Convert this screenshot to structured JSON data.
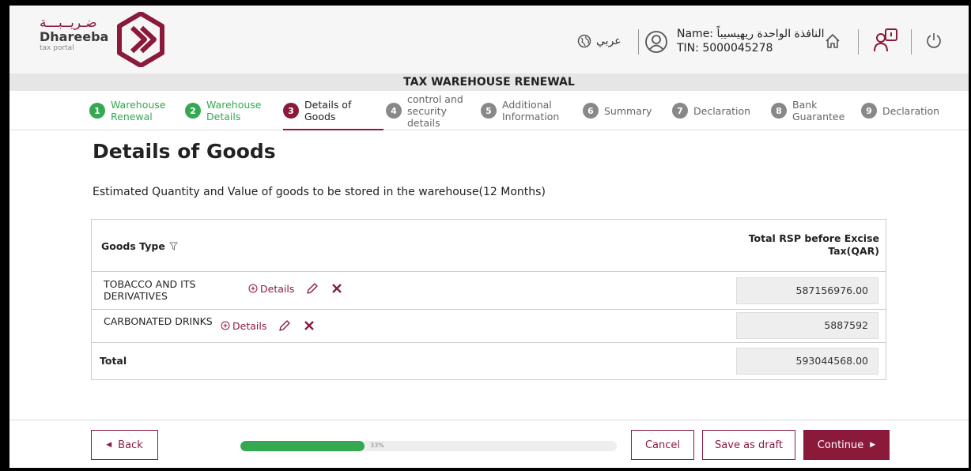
{
  "header": {
    "logo_arabic": "ضـريــبـــة",
    "logo_name": "Dhareeba",
    "logo_sub": "tax portal",
    "language": "عربي",
    "user_name": "Name: النافذة الواحدة ريهيسيباً",
    "user_tin": "TIN: 5000045278",
    "icons": [
      "globe-icon",
      "user-icon",
      "home-icon",
      "help-icon",
      "power-icon"
    ]
  },
  "page_header": "TAX WAREHOUSE RENEWAL",
  "steps": [
    {
      "num": "1",
      "label": "Warehouse Renewal",
      "state": "done"
    },
    {
      "num": "2",
      "label": "Warehouse Details",
      "state": "done"
    },
    {
      "num": "3",
      "label": "Details of Goods",
      "state": "active"
    },
    {
      "num": "4",
      "label": "control and security details",
      "state": "todo"
    },
    {
      "num": "5",
      "label": "Additional Information",
      "state": "todo"
    },
    {
      "num": "6",
      "label": "Summary",
      "state": "todo"
    },
    {
      "num": "7",
      "label": "Declaration",
      "state": "todo"
    },
    {
      "num": "8",
      "label": "Bank Guarantee",
      "state": "todo"
    },
    {
      "num": "9",
      "label": "Declaration",
      "state": "todo"
    }
  ],
  "main": {
    "title": "Details of Goods",
    "subtitle": "Estimated Quantity and Value of goods to be stored in the warehouse(12 Months)"
  },
  "table": {
    "col_goods": "Goods Type",
    "col_total": "Total RSP before Excise Tax(QAR)",
    "details_label": "Details",
    "rows": [
      {
        "type": "TOBACCO AND ITS DERIVATIVES",
        "value": "587156976.00"
      },
      {
        "type": "CARBONATED DRINKS",
        "value": "5887592"
      }
    ],
    "total_label": "Total",
    "total_value": "593044568.00"
  },
  "footer": {
    "back": "Back",
    "progress_text": "33%",
    "progress": 0.33,
    "cancel": "Cancel",
    "save_draft": "Save as draft",
    "continue": "Continue"
  },
  "colors": {
    "brand": "#8b1a3a",
    "done": "#35a852",
    "pending": "#888888"
  }
}
